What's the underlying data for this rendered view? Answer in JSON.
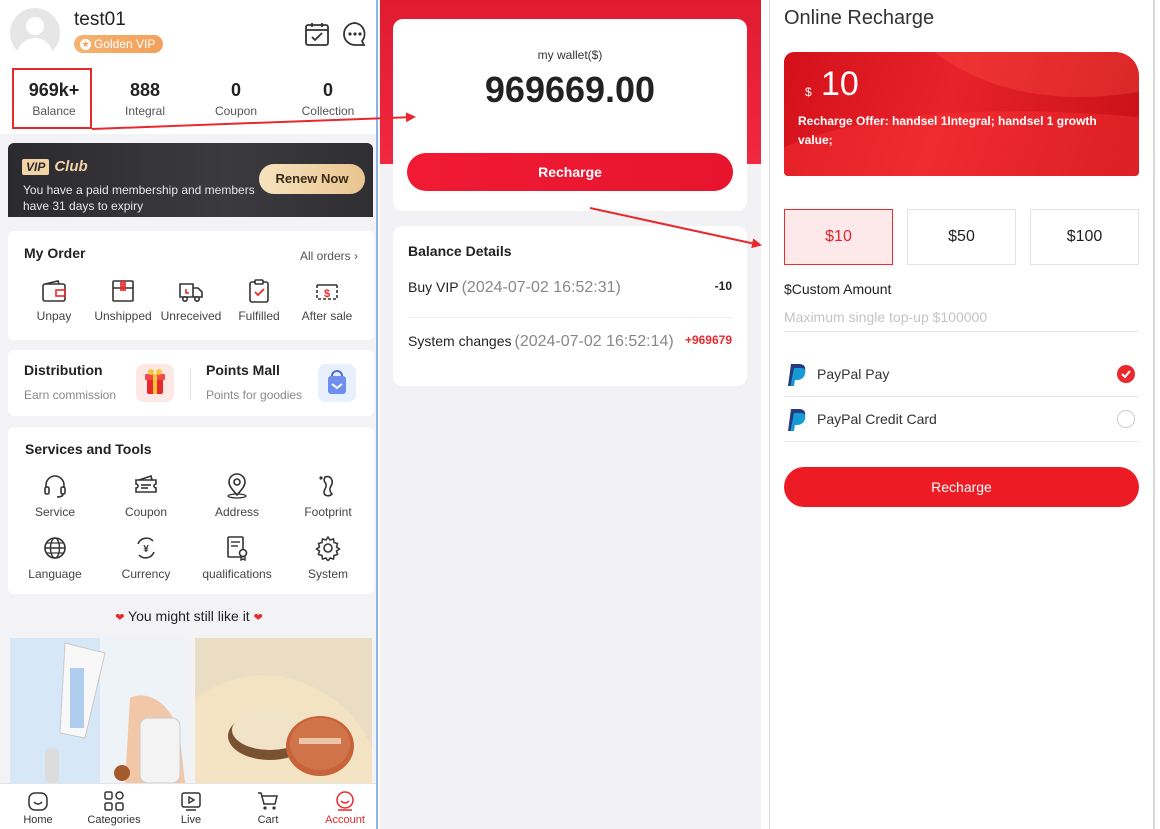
{
  "colors": {
    "brand_red": "#e9282c",
    "text_dark": "#222222",
    "muted": "#888888"
  },
  "profile": {
    "username": "test01",
    "vip_badge": "Golden VIP",
    "stats": [
      {
        "value": "969k+",
        "label": "Balance"
      },
      {
        "value": "888",
        "label": "Integral"
      },
      {
        "value": "0",
        "label": "Coupon"
      },
      {
        "value": "0",
        "label": "Collection"
      }
    ]
  },
  "vip_club": {
    "badge": "VIP",
    "club": "Club",
    "text": "You have a paid membership and members have 31 days to expiry",
    "renew": "Renew Now"
  },
  "my_order": {
    "title": "My Order",
    "all_orders": "All orders",
    "items": [
      "Unpay",
      "Unshipped",
      "Unreceived",
      "Fulfilled",
      "After sale"
    ]
  },
  "distribution": {
    "title": "Distribution",
    "subtitle": "Earn commission"
  },
  "points_mall": {
    "title": "Points Mall",
    "subtitle": "Points for goodies"
  },
  "services": {
    "title": "Services and Tools",
    "items": [
      "Service",
      "Coupon",
      "Address",
      "Footprint",
      "Language",
      "Currency",
      "qualifications",
      "System"
    ]
  },
  "like": {
    "text": "You might still like it"
  },
  "tabbar": [
    "Home",
    "Categories",
    "Live",
    "Cart",
    "Account"
  ],
  "wallet": {
    "label": "my wallet($)",
    "amount": "969669.00",
    "recharge": "Recharge",
    "details_title": "Balance Details",
    "rows": [
      {
        "name": "Buy VIP",
        "date": "(2024-07-02 16:52:31)",
        "amount": "-10"
      },
      {
        "name": "System changes",
        "date": "(2024-07-02 16:52:14)",
        "amount": "+969679"
      }
    ]
  },
  "recharge": {
    "title": "Online Recharge",
    "currency": "$",
    "offer_amount": "10",
    "offer_text": "Recharge Offer:  handsel 1Integral;  handsel 1 growth value;",
    "amounts": [
      "$10",
      "$50",
      "$100"
    ],
    "custom_label": "$Custom Amount",
    "custom_placeholder": "Maximum single top-up $100000",
    "methods": [
      "PayPal Pay",
      "PayPal Credit Card"
    ],
    "button": "Recharge"
  }
}
